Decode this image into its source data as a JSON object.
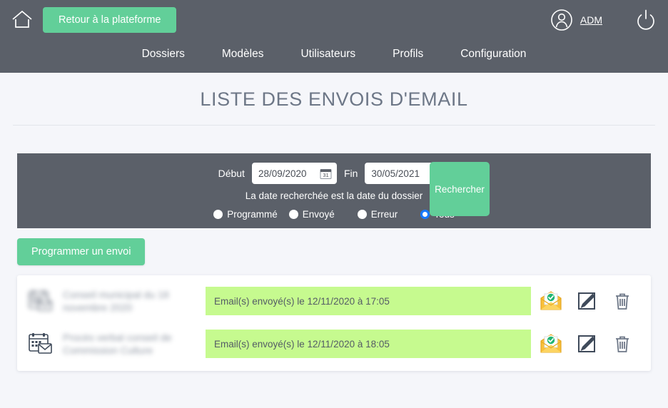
{
  "header": {
    "home_icon": "home-icon",
    "platform_button": "Retour à la plateforme",
    "user_icon": "avatar-icon",
    "user_name": "ADM",
    "power_icon": "power-icon"
  },
  "nav": {
    "items": [
      {
        "label": "Dossiers"
      },
      {
        "label": "Modèles"
      },
      {
        "label": "Utilisateurs"
      },
      {
        "label": "Profils"
      },
      {
        "label": "Configuration"
      }
    ]
  },
  "page": {
    "title": "LISTE DES ENVOIS D'EMAIL"
  },
  "filters": {
    "start_label": "Début",
    "start_value": "28/09/2020",
    "end_label": "Fin",
    "end_value": "30/05/2021",
    "calendar_icon": "calendar-icon",
    "calendar_day": "31",
    "hint": "La date recherchée est la date du dossier",
    "search_button": "Rechercher",
    "radios": [
      {
        "label": "Programmé",
        "checked": false
      },
      {
        "label": "Envoyé",
        "checked": false
      },
      {
        "label": "Erreur",
        "checked": false
      },
      {
        "label": "Tous",
        "checked": true
      }
    ]
  },
  "actions": {
    "program_button": "Programmer un envoi"
  },
  "list": {
    "rows": [
      {
        "icon": "calendar-mail-icon",
        "title": "Conseil municipal du 18 novembre 2020",
        "status": "Email(s) envoyé(s) le 12/11/2020 à 17:05",
        "action_mail_icon": "mail-sent-icon",
        "action_edit_icon": "edit-icon",
        "action_delete_icon": "trash-icon"
      },
      {
        "icon": "calendar-mail-icon",
        "title": "Procès verbal conseil de Commission Culture",
        "status": "Email(s) envoyé(s) le 12/11/2020 à 18:05",
        "action_mail_icon": "mail-sent-icon",
        "action_edit_icon": "edit-icon",
        "action_delete_icon": "trash-icon"
      }
    ]
  },
  "colors": {
    "header_bg": "#5b6069",
    "accent_green": "#62cf99",
    "status_green": "#c6fa8f",
    "page_bg": "#f5f6fa",
    "radio_selected": "#1879ff"
  }
}
